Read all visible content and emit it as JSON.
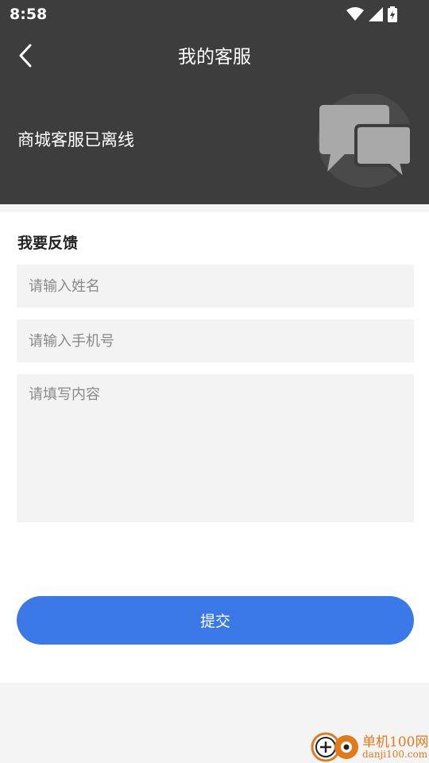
{
  "status_bar": {
    "time": "8:58"
  },
  "nav": {
    "title": "我的客服"
  },
  "service": {
    "status_text": "商城客服已离线"
  },
  "feedback": {
    "section_title": "我要反馈",
    "name_placeholder": "请输入姓名",
    "phone_placeholder": "请输入手机号",
    "content_placeholder": "请填写内容",
    "submit_label": "提交"
  },
  "watermark": {
    "brand": "单机100网",
    "domain": "danji100.com"
  },
  "colors": {
    "header_bg": "#3d3d3d",
    "accent": "#3a78e8",
    "watermark": "#e07a1a"
  }
}
